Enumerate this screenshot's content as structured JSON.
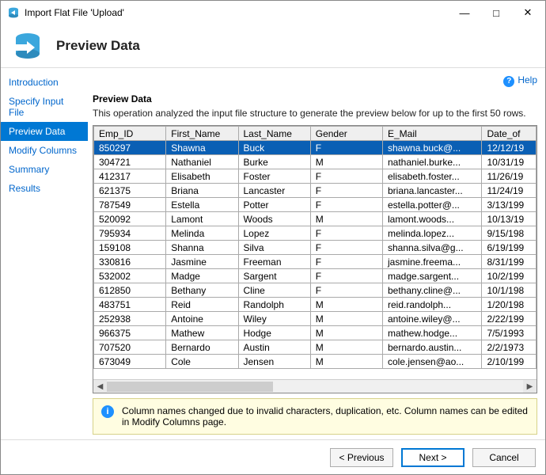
{
  "window": {
    "title": "Import Flat File 'Upload'"
  },
  "header": {
    "title": "Preview Data"
  },
  "help": {
    "label": "Help"
  },
  "sidebar": {
    "items": [
      {
        "label": "Introduction"
      },
      {
        "label": "Specify Input File"
      },
      {
        "label": "Preview Data"
      },
      {
        "label": "Modify Columns"
      },
      {
        "label": "Summary"
      },
      {
        "label": "Results"
      }
    ],
    "selected_index": 2
  },
  "content": {
    "heading": "Preview Data",
    "description": "This operation analyzed the input file structure to generate the preview below for up to the first 50 rows."
  },
  "grid": {
    "columns": [
      "Emp_ID",
      "First_Name",
      "Last_Name",
      "Gender",
      "E_Mail",
      "Date_of"
    ],
    "rows": [
      {
        "id": "850297",
        "fn": "Shawna",
        "ln": "Buck",
        "g": "F",
        "em": "shawna.buck@...",
        "d": "12/12/19"
      },
      {
        "id": "304721",
        "fn": "Nathaniel",
        "ln": "Burke",
        "g": "M",
        "em": "nathaniel.burke...",
        "d": "10/31/19"
      },
      {
        "id": "412317",
        "fn": "Elisabeth",
        "ln": "Foster",
        "g": "F",
        "em": "elisabeth.foster...",
        "d": "11/26/19"
      },
      {
        "id": "621375",
        "fn": "Briana",
        "ln": "Lancaster",
        "g": "F",
        "em": "briana.lancaster...",
        "d": "11/24/19"
      },
      {
        "id": "787549",
        "fn": "Estella",
        "ln": "Potter",
        "g": "F",
        "em": "estella.potter@...",
        "d": "3/13/199"
      },
      {
        "id": "520092",
        "fn": "Lamont",
        "ln": "Woods",
        "g": "M",
        "em": "lamont.woods...",
        "d": "10/13/19"
      },
      {
        "id": "795934",
        "fn": "Melinda",
        "ln": "Lopez",
        "g": "F",
        "em": "melinda.lopez...",
        "d": "9/15/198"
      },
      {
        "id": "159108",
        "fn": "Shanna",
        "ln": "Silva",
        "g": "F",
        "em": "shanna.silva@g...",
        "d": "6/19/199"
      },
      {
        "id": "330816",
        "fn": "Jasmine",
        "ln": "Freeman",
        "g": "F",
        "em": "jasmine.freema...",
        "d": "8/31/199"
      },
      {
        "id": "532002",
        "fn": "Madge",
        "ln": "Sargent",
        "g": "F",
        "em": "madge.sargent...",
        "d": "10/2/199"
      },
      {
        "id": "612850",
        "fn": "Bethany",
        "ln": "Cline",
        "g": "F",
        "em": "bethany.cline@...",
        "d": "10/1/198"
      },
      {
        "id": "483751",
        "fn": "Reid",
        "ln": "Randolph",
        "g": "M",
        "em": "reid.randolph...",
        "d": "1/20/198"
      },
      {
        "id": "252938",
        "fn": "Antoine",
        "ln": "Wiley",
        "g": "M",
        "em": "antoine.wiley@...",
        "d": "2/22/199"
      },
      {
        "id": "966375",
        "fn": "Mathew",
        "ln": "Hodge",
        "g": "M",
        "em": "mathew.hodge...",
        "d": "7/5/1993"
      },
      {
        "id": "707520",
        "fn": "Bernardo",
        "ln": "Austin",
        "g": "M",
        "em": "bernardo.austin...",
        "d": "2/2/1973"
      },
      {
        "id": "673049",
        "fn": "Cole",
        "ln": "Jensen",
        "g": "M",
        "em": "cole.jensen@ao...",
        "d": "2/10/199"
      }
    ],
    "selected_row": 0
  },
  "info": {
    "text": "Column names changed due to invalid characters, duplication, etc. Column names can be edited in Modify Columns page."
  },
  "footer": {
    "previous": "< Previous",
    "next": "Next >",
    "cancel": "Cancel"
  }
}
